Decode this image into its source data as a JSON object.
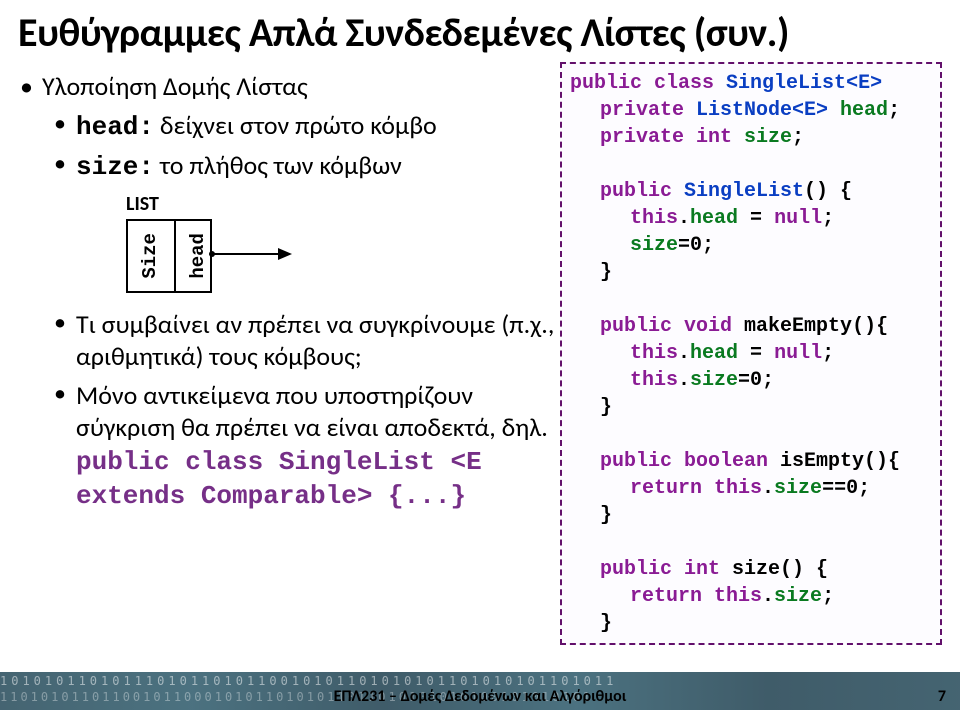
{
  "title": "Ευθύγραμμες Απλά Συνδεδεμένες Λίστες (συν.)",
  "left": {
    "impl": "Υλοποίηση Δομής Λίστας",
    "head_desc_label": "head:",
    "head_desc_rest": " δείχνει στον πρώτο κόμβο",
    "size_desc_label": "size:",
    "size_desc_rest": " το πλήθος των κόμβων",
    "list_word": "LIST",
    "cell_size": "Size",
    "cell_head": "head",
    "q1": "Τι συμβαίνει αν πρέπει να συγκρίνουμε (π.χ., αριθμητικά) τους κόμβους;",
    "q2": "Μόνο αντικείμενα που υποστηρίζουν σύγκριση θα πρέπει να είναι αποδεκτά, δηλ.",
    "decl": "public class SingleList <E extends Comparable> {...}"
  },
  "code": {
    "l1_public": "public ",
    "l1_class": "class ",
    "l1_type": "SingleList",
    "l1_gen": "<E>",
    "l2_private": "private ",
    "l2_type": "ListNode",
    "l2_gen": "<E> ",
    "l2_head": "head",
    "l2_semi": ";",
    "l3_private": "private ",
    "l3_int": "int ",
    "l3_size": "size",
    "l3_semi": ";",
    "ctor_public": "public ",
    "ctor_name": "SingleList",
    "ctor_paren": "() {",
    "ctor_b1_this": "this",
    "ctor_b1_dot": ".",
    "ctor_b1_head": "head",
    "ctor_b1_eq": " = ",
    "ctor_b1_null": "null",
    "ctor_b1_semi": ";",
    "ctor_b2_size": "size",
    "ctor_b2_eq": "=0;",
    "brace_close": "}",
    "me_public": "public ",
    "me_void": "void ",
    "me_name": "makeEmpty",
    "me_paren": "(){",
    "me_b1_this": "this",
    "me_b1": ".",
    "me_b1_head": "head",
    "me_b1_eq": " = ",
    "me_b1_null": "null",
    "me_b1_semi": ";",
    "me_b2_this": "this",
    "me_b2": ".",
    "me_b2_size": "size",
    "me_b2_eq": "=0;",
    "ie_public": "public ",
    "ie_bool": "boolean ",
    "ie_name": "isEmpty",
    "ie_paren": "(){",
    "ie_ret": "return ",
    "ie_this": "this",
    "ie_dot": ".",
    "ie_size": "size",
    "ie_rest": "==0;",
    "sz_public": "public ",
    "sz_int": "int ",
    "sz_name": "size",
    "sz_paren": "() {",
    "sz_ret": "return ",
    "sz_this": "this",
    "sz_dot": ".",
    "sz_size": "size",
    "sz_semi": ";"
  },
  "footer": {
    "center": "ΕΠΛ231 – Δομές Δεδομένων και Αλγόριθμοι",
    "page": "7",
    "bin1": "1010101101011101011010110010101101010101101010101101011",
    "bin2": "1101010110110010110001010110101011011010101010100101010101"
  }
}
